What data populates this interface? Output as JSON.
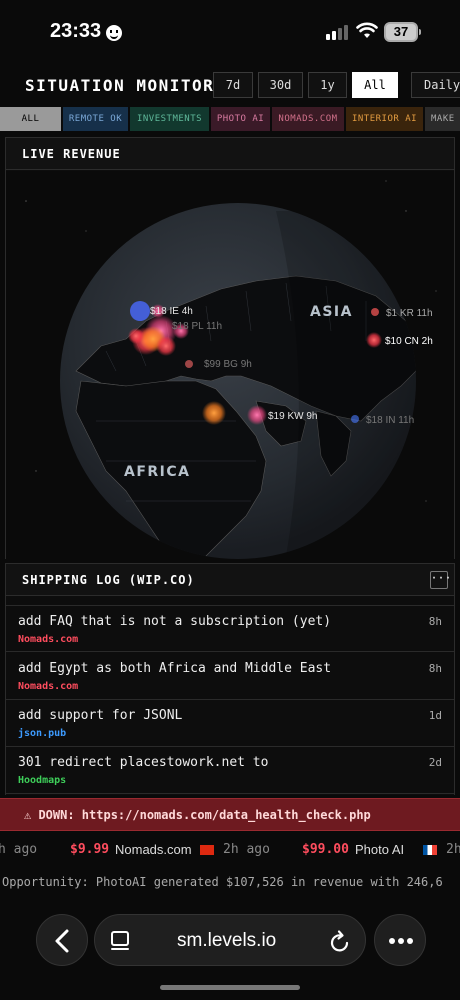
{
  "status_bar": {
    "time": "23:33",
    "battery": "37"
  },
  "header": {
    "title": "SITUATION MONITOR",
    "ranges": [
      "7d",
      "30d",
      "1y",
      "All",
      "Daily"
    ],
    "active_range": "All"
  },
  "categories": [
    {
      "label": "ALL",
      "color": "#9a9a9a",
      "text_color": "#000000"
    },
    {
      "label": "REMOTE OK",
      "color": "#16304a",
      "text_color": "#7aa7d6"
    },
    {
      "label": "INVESTMENTS",
      "color": "#12382e",
      "text_color": "#5fb89a"
    },
    {
      "label": "PHOTO AI",
      "color": "#3a1a28",
      "text_color": "#d77aa0"
    },
    {
      "label": "NOMADS.COM",
      "color": "#3a1a24",
      "text_color": "#d0708a"
    },
    {
      "label": "INTERIOR AI",
      "color": "#3a240c",
      "text_color": "#e09a40"
    },
    {
      "label": "MAKE",
      "color": "#2a2a2a",
      "text_color": "#aaaaaa"
    }
  ],
  "revenue_panel": {
    "title": "LIVE REVENUE",
    "regions": [
      "ASIA",
      "AFRICA"
    ],
    "markers": [
      {
        "label": "$18 IE 4h",
        "color": "#ff5a5a"
      },
      {
        "label": "$18 PL 11h",
        "color": "#ff5a5a"
      },
      {
        "label": "$99 BG 9h",
        "color": "#ff5a5a"
      },
      {
        "label": "$19 KW 9h",
        "color": "#ff5a8a"
      },
      {
        "label": "$1 KR 11h",
        "color": "#ff5a5a"
      },
      {
        "label": "$10 CN 2h",
        "color": "#ff4a4a"
      },
      {
        "label": "$18 IN 11h",
        "color": "#5a8aff"
      }
    ]
  },
  "shipping_panel": {
    "title": "SHIPPING LOG (WIP.CO)",
    "more_label": "···",
    "entries": [
      {
        "title": "add FAQ that is not a subscription (yet)",
        "project": "Nomads.com",
        "project_color": "#ff4d5e",
        "age": "8h"
      },
      {
        "title": "add Egypt as both Africa and Middle East",
        "project": "Nomads.com",
        "project_color": "#ff4d5e",
        "age": "8h"
      },
      {
        "title": "add support for JSONL",
        "project": "json.pub",
        "project_color": "#3d9bff",
        "age": "1d"
      },
      {
        "title": "301 redirect placestowork.net to",
        "project": "Hoodmaps",
        "project_color": "#3ecf5a",
        "age": "2d"
      }
    ]
  },
  "alert": {
    "text": "⚠ DOWN: https://nomads.com/data_health_check.php"
  },
  "ticker": {
    "lead": "h ago",
    "item1_amount": "$9.99",
    "item1_name": "Nomads.com",
    "item1_age": "2h ago",
    "item2_amount": "$99.00",
    "item2_name": "Photo AI",
    "item2_age": "2h"
  },
  "opportunity": "Opportunity: PhotoAI generated $107,526 in revenue with 246,6",
  "browser": {
    "url": "sm.levels.io"
  }
}
